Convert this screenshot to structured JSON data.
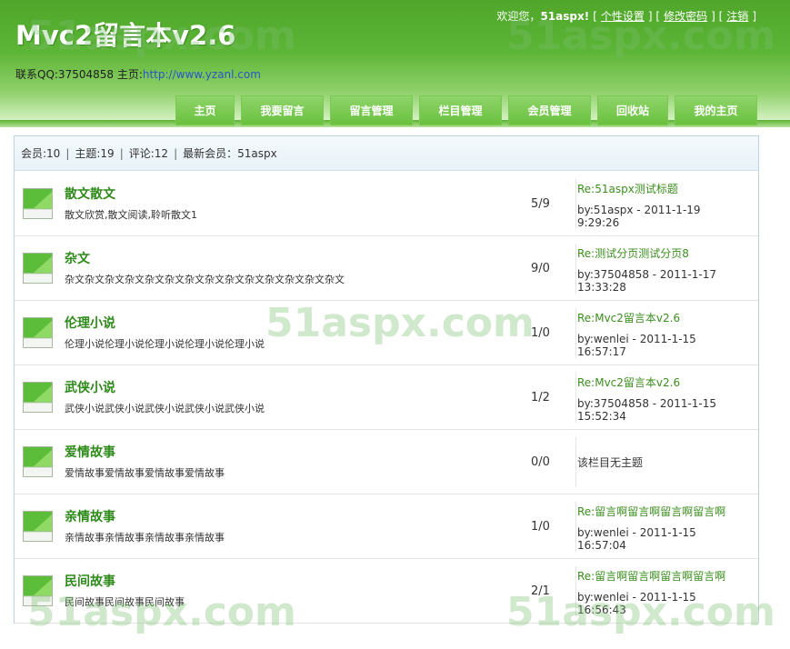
{
  "header": {
    "logo": "Mvc2留言本v2.6",
    "contact_prefix": "联系QQ:37504858 主页:",
    "contact_url": "http://www.yzanl.com",
    "welcome": "欢迎您，",
    "username": "51aspx",
    "exclaim": "!",
    "links": [
      "个性设置",
      "修改密码",
      "注销"
    ]
  },
  "nav": [
    "主页",
    "我要留言",
    "留言管理",
    "栏目管理",
    "会员管理",
    "回收站",
    "我的主页"
  ],
  "stats": {
    "members": "会员:10",
    "topics": "主题:19",
    "comments": "评论:12",
    "latest": "最新会员：51aspx"
  },
  "forums": [
    {
      "title": "散文散文",
      "desc": "散文欣赏,散文阅读,聆听散文1",
      "count": "5/9",
      "last_title": "Re:51aspx测试标题",
      "last_by": "by:51aspx - 2011-1-19",
      "last_time": "9:29:26"
    },
    {
      "title": "杂文",
      "desc": "杂文杂文杂文杂文杂文杂文杂文杂文杂文杂文杂文杂文杂文杂文",
      "count": "9/0",
      "last_title": "Re:测试分页测试分页8",
      "last_by": "by:37504858 - 2011-1-17",
      "last_time": "13:33:28"
    },
    {
      "title": "伦理小说",
      "desc": "伦理小说伦理小说伦理小说伦理小说伦理小说",
      "count": "1/0",
      "last_title": "Re:Mvc2留言本v2.6",
      "last_by": "by:wenlei - 2011-1-15",
      "last_time": "16:57:17"
    },
    {
      "title": "武侠小说",
      "desc": "武侠小说武侠小说武侠小说武侠小说武侠小说",
      "count": "1/2",
      "last_title": "Re:Mvc2留言本v2.6",
      "last_by": "by:37504858 - 2011-1-15",
      "last_time": "15:52:34"
    },
    {
      "title": "爱情故事",
      "desc": "爱情故事爱情故事爱情故事爱情故事",
      "count": "0/0",
      "empty": "该栏目无主题"
    },
    {
      "title": "亲情故事",
      "desc": "亲情故事亲情故事亲情故事亲情故事",
      "count": "1/0",
      "last_title": "Re:留言啊留言啊留言啊留言啊",
      "last_by": "by:wenlei - 2011-1-15",
      "last_time": "16:57:04"
    },
    {
      "title": "民间故事",
      "desc": "民间故事民间故事民间故事",
      "count": "2/1",
      "last_title": "Re:留言啊留言啊留言啊留言啊",
      "last_by": "by:wenlei - 2011-1-15",
      "last_time": "16:56:43"
    }
  ],
  "watermark": "51aspx.com",
  "colors": {
    "brand_green": "#5cb536",
    "title_green": "#2e8a1a",
    "link_blue": "#2a56c6"
  }
}
